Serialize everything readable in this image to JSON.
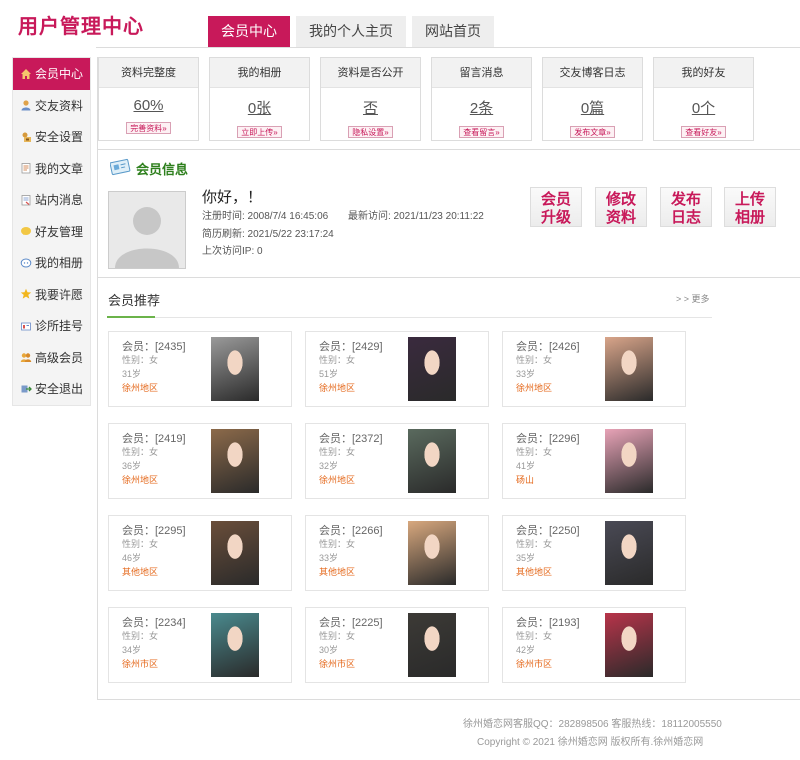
{
  "header": {
    "title": "用户管理中心",
    "tabs": [
      {
        "label": "会员中心",
        "active": true
      },
      {
        "label": "我的个人主页",
        "active": false
      },
      {
        "label": "网站首页",
        "active": false
      }
    ]
  },
  "sidebar": {
    "items": [
      {
        "label": "会员中心",
        "icon": "home-icon",
        "active": true
      },
      {
        "label": "交友资料",
        "icon": "user-icon"
      },
      {
        "label": "安全设置",
        "icon": "lock-icon"
      },
      {
        "label": "我的文章",
        "icon": "article-icon"
      },
      {
        "label": "站内消息",
        "icon": "message-icon"
      },
      {
        "label": "好友管理",
        "icon": "friends-icon"
      },
      {
        "label": "我的相册",
        "icon": "album-icon"
      },
      {
        "label": "我要许愿",
        "icon": "star-icon"
      },
      {
        "label": "诊所挂号",
        "icon": "clinic-icon"
      },
      {
        "label": "高级会员",
        "icon": "vip-icon"
      },
      {
        "label": "安全退出",
        "icon": "logout-icon"
      }
    ]
  },
  "stats": [
    {
      "title": "资料完整度",
      "value": "60%",
      "button": "完善资料»"
    },
    {
      "title": "我的相册",
      "value": "0张",
      "button": "立即上传»"
    },
    {
      "title": "资料是否公开",
      "value": "否",
      "button": "隐私设置»"
    },
    {
      "title": "留言消息",
      "value": "2条",
      "button": "查看留言»"
    },
    {
      "title": "交友博客日志",
      "value": "0篇",
      "button": "发布文章»"
    },
    {
      "title": "我的好友",
      "value": "0个",
      "button": "查看好友»"
    }
  ],
  "member_info": {
    "title": "会员信息",
    "greeting": "你好，！",
    "register_time": "注册时间: 2008/7/4 16:45:06",
    "last_visit": "最新访问: 2021/11/23 20:11:22",
    "resume_refresh": "简历刷新: 2021/5/22 23:17:24",
    "last_ip": "上次访问IP: 0",
    "actions": [
      {
        "line1": "会员",
        "line2": "升级"
      },
      {
        "line1": "修改",
        "line2": "资料"
      },
      {
        "line1": "发布",
        "line2": "日志"
      },
      {
        "line1": "上传",
        "line2": "相册"
      }
    ]
  },
  "recommend": {
    "title": "会员推荐",
    "more": "> > 更多",
    "members": [
      {
        "id": "会员：[2435]",
        "sex": "性别：女",
        "age": "31岁",
        "area": "徐州地区",
        "photo_color": "#9a9a9a"
      },
      {
        "id": "会员：[2429]",
        "sex": "性别：女",
        "age": "51岁",
        "area": "徐州地区",
        "photo_color": "#3a2a3e"
      },
      {
        "id": "会员：[2426]",
        "sex": "性别：女",
        "age": "33岁",
        "area": "徐州地区",
        "photo_color": "#d9a58a"
      },
      {
        "id": "会员：[2419]",
        "sex": "性别：女",
        "age": "36岁",
        "area": "徐州地区",
        "photo_color": "#8c6a4a"
      },
      {
        "id": "会员：[2372]",
        "sex": "性别：女",
        "age": "32岁",
        "area": "徐州地区",
        "photo_color": "#5a6a5e"
      },
      {
        "id": "会员：[2296]",
        "sex": "性别：女",
        "age": "41岁",
        "area": "砀山",
        "photo_color": "#e8a3b7"
      },
      {
        "id": "会员：[2295]",
        "sex": "性别：女",
        "age": "46岁",
        "area": "其他地区",
        "photo_color": "#6a4e3a"
      },
      {
        "id": "会员：[2266]",
        "sex": "性别：女",
        "age": "33岁",
        "area": "其他地区",
        "photo_color": "#d8a87e"
      },
      {
        "id": "会员：[2250]",
        "sex": "性别：女",
        "age": "35岁",
        "area": "其他地区",
        "photo_color": "#4a4a55"
      },
      {
        "id": "会员：[2234]",
        "sex": "性别：女",
        "age": "34岁",
        "area": "徐州市区",
        "photo_color": "#4a8a8e"
      },
      {
        "id": "会员：[2225]",
        "sex": "性别：女",
        "age": "30岁",
        "area": "徐州市区",
        "photo_color": "#3c3a36"
      },
      {
        "id": "会员：[2193]",
        "sex": "性别：女",
        "age": "42岁",
        "area": "徐州市区",
        "photo_color": "#b8344a"
      }
    ]
  },
  "footer": {
    "line1": "徐州婚恋网客服QQ：282898506 客服热线：18112005550",
    "line2": "Copyright © 2021 徐州婚恋网 版权所有.徐州婚恋网"
  },
  "colors": {
    "accent": "#c8195a",
    "green": "#2d7f1c",
    "area_orange": "#e56a1e"
  }
}
